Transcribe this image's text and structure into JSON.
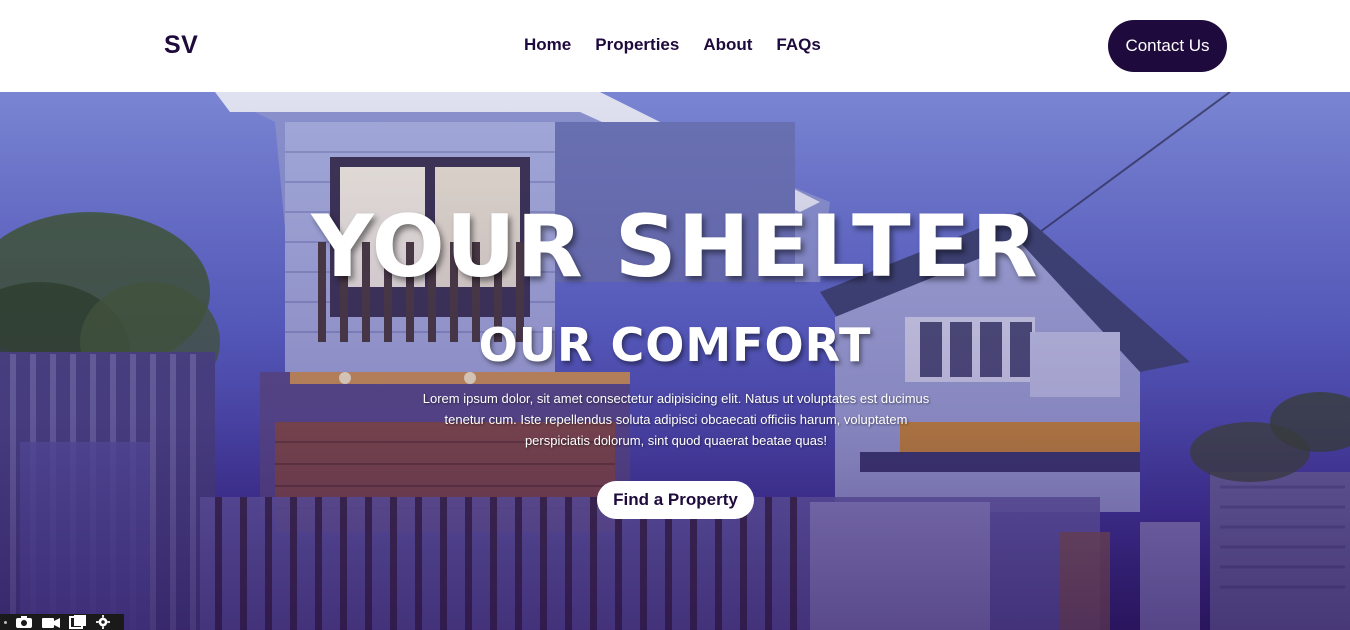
{
  "navbar": {
    "logo": "SV",
    "links": [
      "Home",
      "Properties",
      "About",
      "FAQs"
    ],
    "contact_label": "Contact Us"
  },
  "hero": {
    "title": "YOUR SHELTER",
    "subtitle": "OUR COMFORT",
    "text": "Lorem ipsum dolor, sit amet consectetur adipisicing elit. Natus ut voluptates est ducimus tenetur cum. Iste repellendus soluta adipisci obcaecati officiis harum, voluptatem perspiciatis dolorum, sint quod quaerat beatae quas!",
    "cta_label": "Find a Property"
  },
  "toolbar": {
    "icons": [
      "camera-icon",
      "video-icon",
      "window-icon",
      "gear-icon"
    ]
  },
  "colors": {
    "brand": "#1e0a3c",
    "hero_sky": "#5a64c6",
    "white": "#ffffff"
  }
}
